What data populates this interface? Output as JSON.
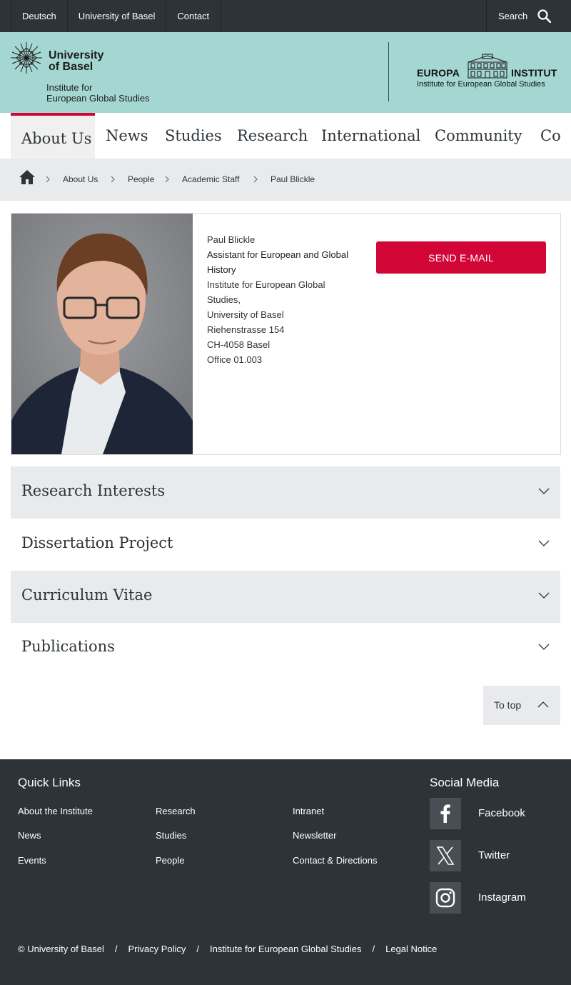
{
  "topbar": {
    "links": [
      "Deutsch",
      "University of Basel",
      "Contact"
    ],
    "search_label": "Search"
  },
  "header": {
    "university_line1": "University",
    "university_line2": "of Basel",
    "institute_line1": "Institute for",
    "institute_line2": "European Global Studies",
    "europa_left": "EUROPA",
    "europa_right": "INSTITUT",
    "europa_sub": "Institute for European Global Studies"
  },
  "nav": {
    "items": [
      "About Us",
      "News",
      "Studies",
      "Research",
      "International",
      "Community",
      "Co"
    ],
    "active_index": 0
  },
  "breadcrumb": {
    "items": [
      "About Us",
      "People",
      "Academic Staff",
      "Paul Blickle"
    ]
  },
  "profile": {
    "name": "Paul Blickle",
    "role_line1": "Assistant for European and Global",
    "role_line2": "History",
    "address": [
      "Institute for European Global",
      "Studies,",
      "University of Basel",
      "Riehenstrasse 154",
      "CH-4058 Basel",
      "Office 01.003"
    ],
    "email_button": "SEND E-MAIL"
  },
  "accordion": {
    "items": [
      "Research Interests",
      "Dissertation Project",
      "Curriculum Vitae",
      "Publications"
    ]
  },
  "to_top_label": "To top",
  "footer": {
    "quick_links_title": "Quick Links",
    "quick_links": [
      [
        "About the Institute",
        "News",
        "Events"
      ],
      [
        "Research",
        "Studies",
        "People"
      ],
      [
        "Intranet",
        "Newsletter",
        "Contact & Directions"
      ]
    ],
    "social_title": "Social Media",
    "social": [
      "Facebook",
      "Twitter",
      "Instagram"
    ],
    "legal": [
      "© University of Basel",
      "Privacy Policy",
      "Institute for European Global Studies",
      "Legal Notice"
    ]
  },
  "colors": {
    "dark": "#2d3439",
    "mint": "#a5d7d2",
    "accent_red": "#d20537",
    "light_gray": "#e9eaec"
  }
}
